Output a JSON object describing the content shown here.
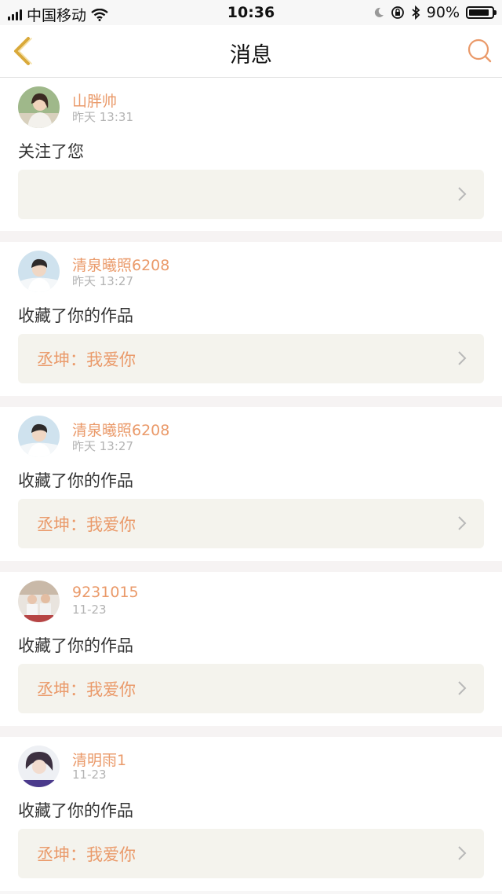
{
  "status_bar": {
    "carrier": "中国移动",
    "time": "10:36",
    "battery": "90%",
    "battery_level": 0.9
  },
  "nav": {
    "title": "消息",
    "back_icon": "chevron-left-icon",
    "search_icon": "search-icon",
    "accent_color": "#d9a93a"
  },
  "colors": {
    "name": "#ea9a6a",
    "time": "#b3b3b3",
    "work_box_bg": "#f4f3ed"
  },
  "messages": [
    {
      "name": "山胖帅",
      "time": "昨天 13:31",
      "action": "关注了您",
      "work_title": ""
    },
    {
      "name": "清泉曦照6208",
      "time": "昨天 13:27",
      "action": "收藏了你的作品",
      "work_title": "丞坤：我爱你"
    },
    {
      "name": "清泉曦照6208",
      "time": "昨天 13:27",
      "action": "收藏了你的作品",
      "work_title": "丞坤：我爱你"
    },
    {
      "name": "9231015",
      "time": "11-23",
      "action": "收藏了你的作品",
      "work_title": "丞坤：我爱你"
    },
    {
      "name": "清明雨1",
      "time": "11-23",
      "action": "收藏了你的作品",
      "work_title": "丞坤：我爱你"
    }
  ]
}
